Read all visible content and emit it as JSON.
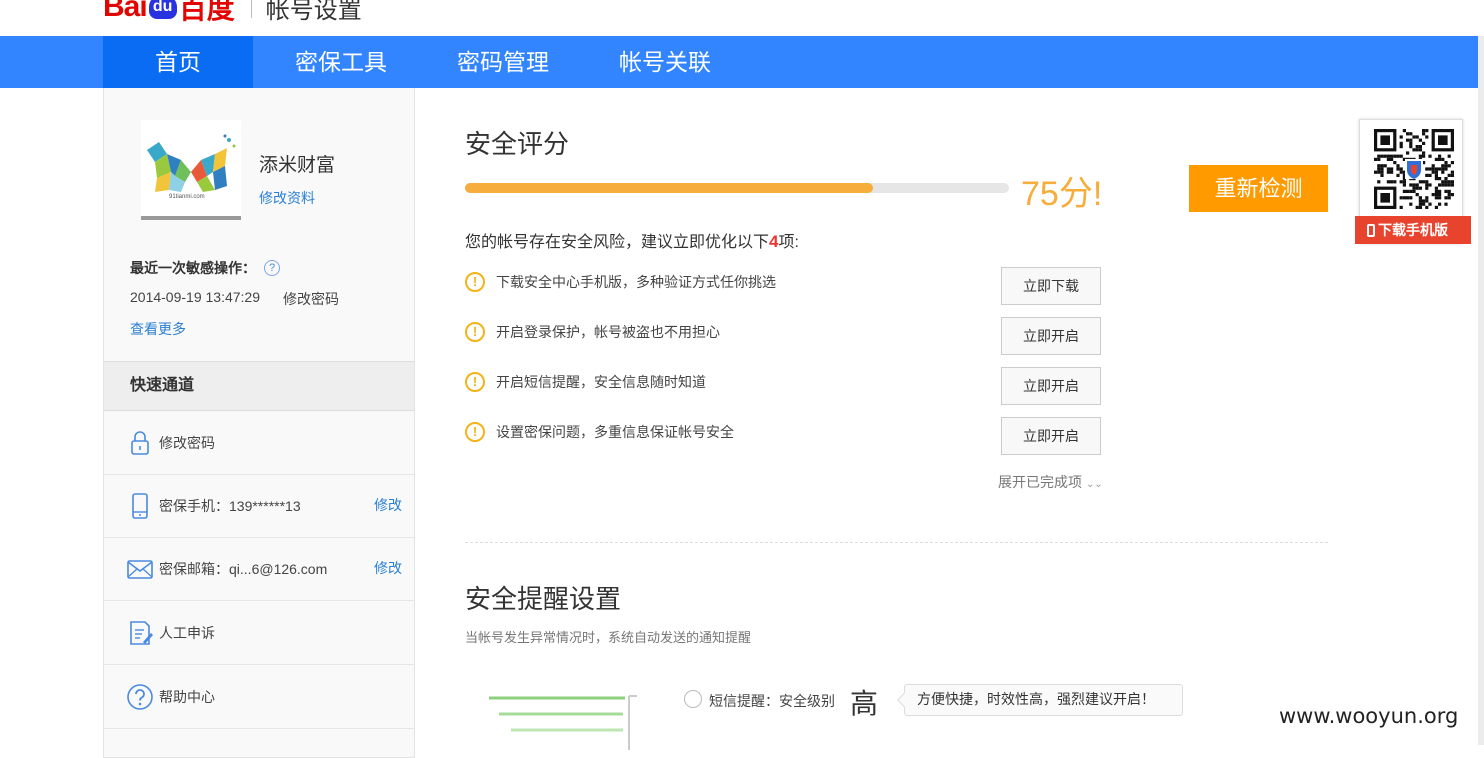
{
  "header": {
    "logo_latin": "Bai",
    "logo_paw": "du",
    "logo_cn": "百度",
    "subtitle": "帐号设置"
  },
  "nav": {
    "tabs": [
      {
        "label": "首页",
        "active": true
      },
      {
        "label": "密保工具",
        "active": false
      },
      {
        "label": "密码管理",
        "active": false
      },
      {
        "label": "帐号关联",
        "active": false
      }
    ]
  },
  "profile": {
    "avatar_caption": "91tianmi.com",
    "username": "添米财富",
    "edit_link": "修改资料"
  },
  "recent": {
    "title": "最近一次敏感操作：",
    "help_glyph": "?",
    "time": "2014-09-19 13:47:29",
    "operation": "修改密码",
    "view_more": "查看更多"
  },
  "quick": {
    "title": "快速通道",
    "items": [
      {
        "icon": "lock-icon",
        "label": "修改密码",
        "action": ""
      },
      {
        "icon": "mobile-phone-icon",
        "label": "密保手机：139******13",
        "action": "修改"
      },
      {
        "icon": "envelope-icon",
        "label": "密保邮箱：qi...6@126.com",
        "action": "修改"
      },
      {
        "icon": "document-edit-icon",
        "label": "人工申诉",
        "action": ""
      },
      {
        "icon": "question-circle-icon",
        "label": "帮助中心",
        "action": ""
      }
    ]
  },
  "security": {
    "title": "安全评分",
    "score_label": "75分!",
    "progress": 0.75,
    "recheck_label": "重新检测",
    "risk_prefix": "您的帐号存在安全风险，建议立即优化以下",
    "risk_count": "4",
    "risk_suffix": "项:",
    "warn_glyph": "!",
    "tasks": [
      {
        "text": "下载安全中心手机版，多种验证方式任你挑选",
        "button": "立即下载"
      },
      {
        "text": "开启登录保护，帐号被盗也不用担心",
        "button": "立即开启"
      },
      {
        "text": "开启短信提醒，安全信息随时知道",
        "button": "立即开启"
      },
      {
        "text": "设置密保问题，多重信息保证帐号安全",
        "button": "立即开启"
      }
    ],
    "expand_label": "展开已完成项",
    "expand_glyph": "⌄⌄"
  },
  "alerts": {
    "title": "安全提醒设置",
    "description": "当帐号发生异常情况时，系统自动发送的通知提醒",
    "sms_label": "短信提醒：安全级别",
    "sms_level": "高",
    "tip": "方便快捷，时效性高，强烈建议开启！"
  },
  "qr_promo": {
    "download_label": "下载手机版"
  },
  "watermark": "www.wooyun.org",
  "colors": {
    "nav_bg": "#3285ff",
    "nav_active": "#0a6cf2",
    "score": "#f6ad3c",
    "recheck": "#ff9a00",
    "link": "#2a7fd4",
    "warn": "#f2b416",
    "brand_red": "#e10602"
  }
}
